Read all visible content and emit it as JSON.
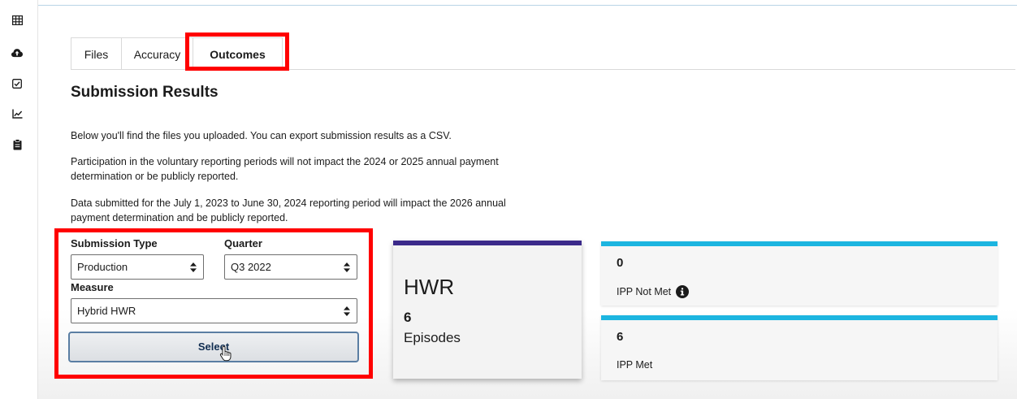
{
  "sidebar": {
    "items": [
      {
        "icon": "table-icon"
      },
      {
        "icon": "cloud-upload-icon"
      },
      {
        "icon": "checkbox-icon"
      },
      {
        "icon": "line-chart-icon"
      },
      {
        "icon": "clipboard-icon"
      }
    ]
  },
  "tabs": [
    {
      "label": "Files"
    },
    {
      "label": "Accuracy"
    },
    {
      "label": "Outcomes",
      "active": true
    }
  ],
  "page": {
    "title": "Submission Results",
    "paragraphs": [
      "Below you'll find the files you uploaded. You can export submission results as a CSV.",
      "Participation in the voluntary reporting periods will not impact the 2024 or 2025 annual payment determination or be publicly reported.",
      "Data submitted for the July 1, 2023 to June 30, 2024 reporting period will impact the 2026 annual payment determination and be publicly reported."
    ]
  },
  "filters": {
    "submission_type": {
      "label": "Submission Type",
      "value": "Production"
    },
    "quarter": {
      "label": "Quarter",
      "value": "Q3 2022"
    },
    "measure": {
      "label": "Measure",
      "value": "Hybrid HWR"
    },
    "select_label": "Select"
  },
  "summary": {
    "hwr": {
      "title": "HWR",
      "count": "6",
      "unit": "Episodes"
    },
    "ipp_not_met": {
      "value": "0",
      "label": "IPP Not Met"
    },
    "ipp_met": {
      "value": "6",
      "label": "IPP Met"
    }
  },
  "colors": {
    "highlight": "#ff0000",
    "hwr_accent": "#3b2a8a",
    "ipp_accent": "#1cb5e0",
    "button_text": "#112e51"
  }
}
